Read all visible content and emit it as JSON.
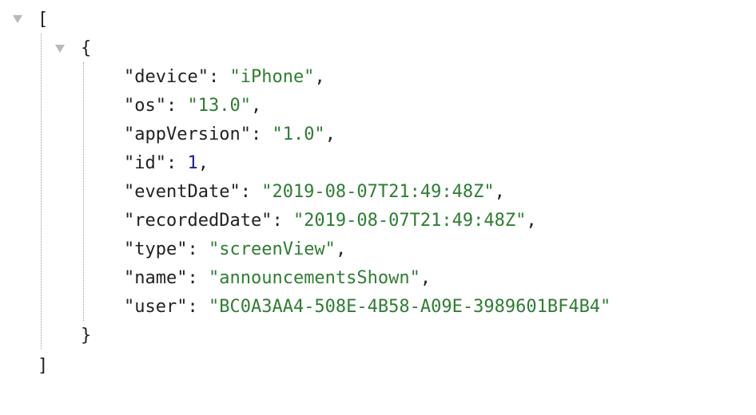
{
  "json_viewer": {
    "open_array": "[",
    "close_array": "]",
    "open_object": "{",
    "close_object": "}",
    "colon": ": ",
    "comma": ",",
    "entries": [
      {
        "key": "\"device\"",
        "value": "\"iPhone\"",
        "type": "string"
      },
      {
        "key": "\"os\"",
        "value": "\"13.0\"",
        "type": "string"
      },
      {
        "key": "\"appVersion\"",
        "value": "\"1.0\"",
        "type": "string"
      },
      {
        "key": "\"id\"",
        "value": "1",
        "type": "number"
      },
      {
        "key": "\"eventDate\"",
        "value": "\"2019-08-07T21:49:48Z\"",
        "type": "string"
      },
      {
        "key": "\"recordedDate\"",
        "value": "\"2019-08-07T21:49:48Z\"",
        "type": "string"
      },
      {
        "key": "\"type\"",
        "value": "\"screenView\"",
        "type": "string"
      },
      {
        "key": "\"name\"",
        "value": "\"announcementsShown\"",
        "type": "string"
      },
      {
        "key": "\"user\"",
        "value": "\"BC0A3AA4-508E-4B58-A09E-3989601BF4B4\"",
        "type": "string"
      }
    ]
  },
  "colors": {
    "string": "#2e7d32",
    "number": "#1a1aa6",
    "key": "#222222",
    "toggle": "#b9b9b9",
    "guide": "#9a9a9a"
  },
  "icons": {
    "array_toggle": "triangle-down-icon",
    "object_toggle": "triangle-down-icon"
  }
}
